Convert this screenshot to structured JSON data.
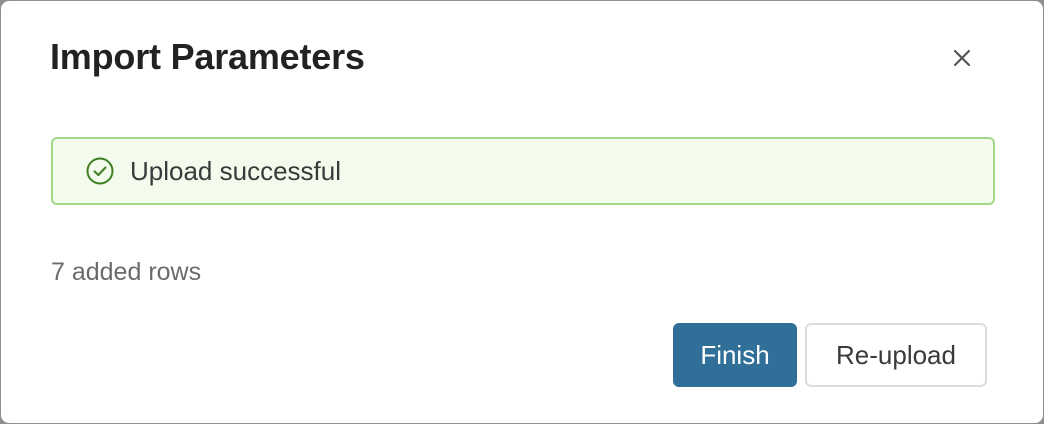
{
  "dialog": {
    "title": "Import Parameters",
    "close_icon": "close-icon",
    "alert": {
      "icon": "check-circle-icon",
      "text": "Upload successful",
      "status": "success",
      "background_color": "#f2fbec",
      "border_color": "#a3d88b",
      "icon_color": "#3f7f24"
    },
    "rows_summary": "7 added rows",
    "buttons": {
      "finish_label": "Finish",
      "reupload_label": "Re-upload",
      "primary_color": "#2f6f98"
    }
  }
}
